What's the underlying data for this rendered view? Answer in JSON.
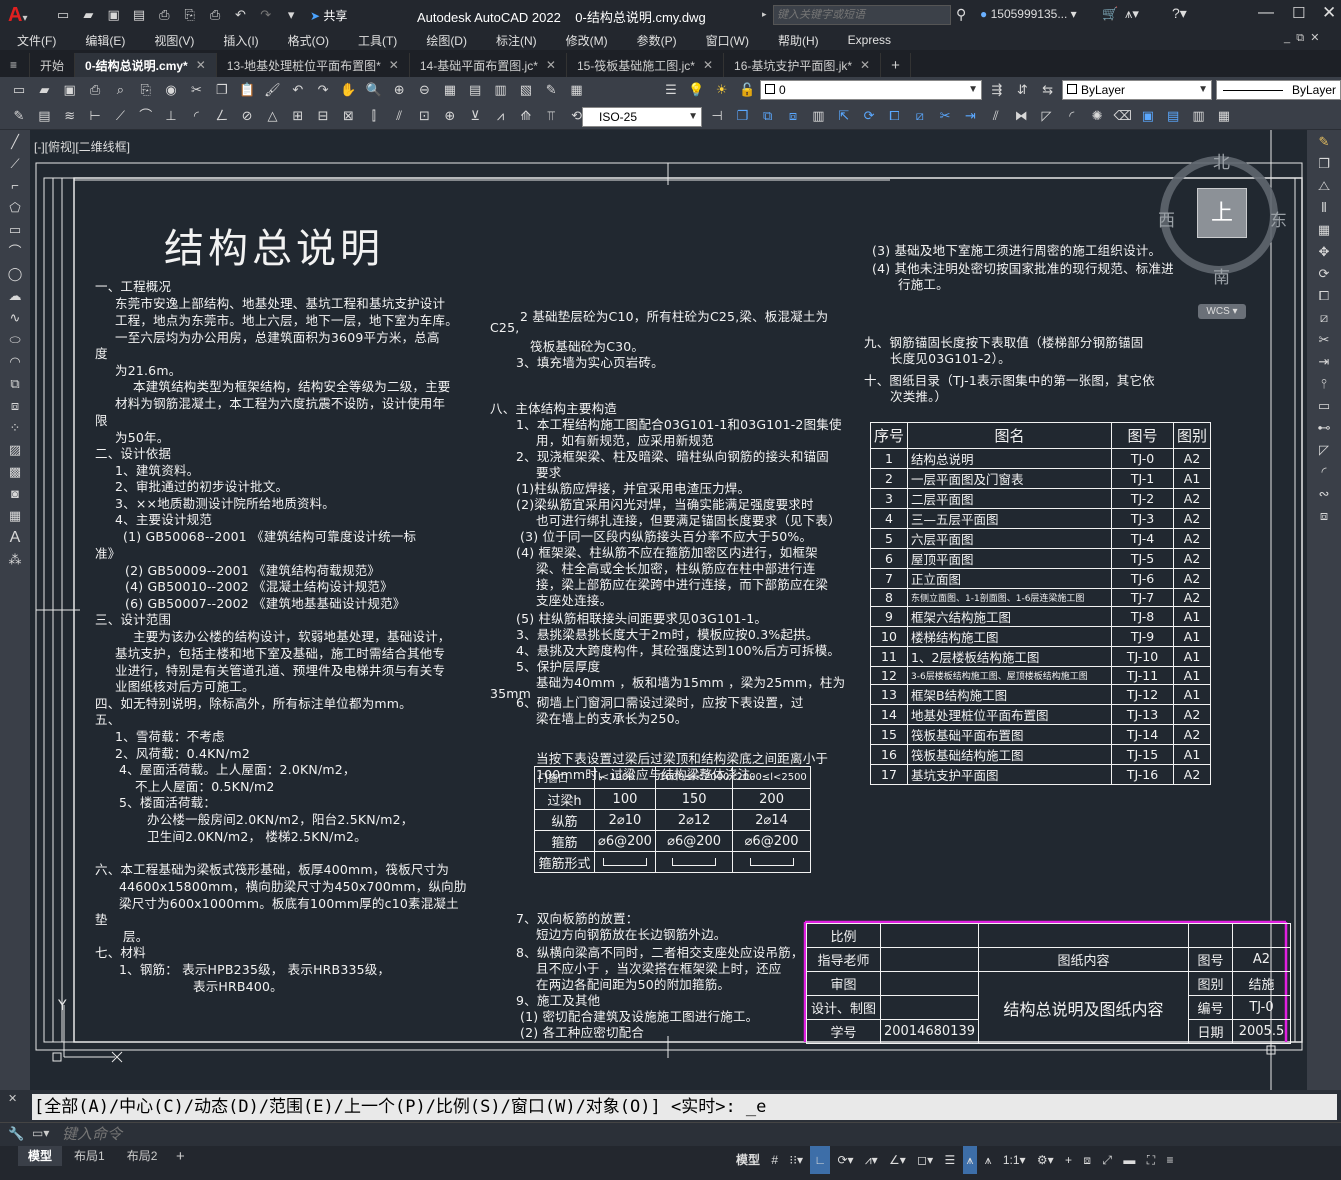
{
  "app": {
    "title": "Autodesk AutoCAD 2022",
    "file": "0-结构总说明.cmy.dwg",
    "share": "共享",
    "search_placeholder": "键入关键字或短语",
    "user": "1505999135...",
    "logo": "A"
  },
  "menu": [
    "文件(F)",
    "编辑(E)",
    "视图(V)",
    "插入(I)",
    "格式(O)",
    "工具(T)",
    "绘图(D)",
    "标注(N)",
    "修改(M)",
    "参数(P)",
    "窗口(W)",
    "帮助(H)",
    "Express"
  ],
  "tabs": [
    {
      "label": "开始",
      "active": false,
      "closable": false
    },
    {
      "label": "0-结构总说明.cmy*",
      "active": true,
      "closable": true
    },
    {
      "label": "13-地基处理桩位平面布置图*",
      "active": false,
      "closable": true
    },
    {
      "label": "14-基础平面布置图.jc*",
      "active": false,
      "closable": true
    },
    {
      "label": "15-筏板基础施工图.jc*",
      "active": false,
      "closable": true
    },
    {
      "label": "16-基坑支护平面图.jk*",
      "active": false,
      "closable": true
    }
  ],
  "toolbar": {
    "layer_value": "0",
    "color_value": "ByLayer",
    "linetype_value": "ByLayer",
    "dimstyle_value": "ISO-25"
  },
  "viewport_label": "[-][俯视][二维线框]",
  "viewcube": {
    "north": "北",
    "south": "南",
    "east": "东",
    "west": "西",
    "top": "上",
    "wcs": "WCS"
  },
  "drawing": {
    "title": "结构总说明",
    "col1": [
      "一、工程概况",
      "东莞市安逸上部结构、地基处理、基坑工程和基坑支护设计",
      "工程，地点为东莞市。地上六层，地下一层，地下室为车库。",
      "一至六层均为办公用房，总建筑面积为3609平方米，总高",
      "度",
      "为21.6m。",
      "本建筑结构类型为框架结构，结构安全等级为二级，主要",
      "材料为钢筋混凝土，本工程为六度抗震不设防，设计使用年",
      "限",
      "为50年。",
      "二、设计依据",
      "1、建筑资料。",
      "2、审批通过的初步设计批文。",
      "3、××地质勘测设计院所给地质资料。",
      "4、主要设计规范",
      "(1) GB50068--2001 《建筑结构可靠度设计统一标",
      "准》",
      "(2) GB50009--2001 《建筑结构荷载规范》",
      "(4) GB50010--2002 《混凝土结构设计规范》",
      "(6) GB50007--2002 《建筑地基基础设计规范》",
      "三、设计范围",
      "主要为该办公楼的结构设计，软弱地基处理，基础设计，",
      "基坑支护，包括主楼和地下室及基础，施工时需结合其他专",
      "业进行，特别是有关管道孔道、预埋件及电梯井须与有关专",
      "业图纸核对后方可施工。",
      "四、如无特别说明，除标高外，所有标注单位都为mm。",
      "五、",
      "1、雪荷载：不考虑",
      "2、风荷载：0.4KN/m2",
      "4、屋面活荷载。上人屋面：2.0KN/m2，",
      "不上人屋面：0.5KN/m2",
      "5、楼面活荷载：",
      "办公楼一般房间2.0KN/m2，阳台2.5KN/m2，",
      "卫生间2.0KN/m2， 楼梯2.5KN/m2。",
      "六、本工程基础为梁板式筏形基础，板厚400mm，筏板尺寸为",
      "44600x15800mm，横向肋梁尺寸为450x700mm，纵向肋",
      "梁尺寸为600x1000mm。板底有100mm厚的c10素混凝土",
      "垫",
      "层。",
      "七、材料",
      "1、钢筋： 表示HPB235级， 表示HRB335级，",
      "表示HRB400。"
    ],
    "col2": [
      "2 基础垫层砼为C10，所有柱砼为C25,梁、板混凝土为",
      "C25,",
      "筏板基础砼为C30。",
      "3、填充墙为实心页岩砖。",
      "八、主体结构主要构造",
      "1、本工程结构施工图配合03G101-1和03G101-2图集使",
      "用，如有新规范，应采用新规范",
      "2、现浇框架梁、柱及暗梁、暗柱纵向钢筋的接头和锚固",
      "要求",
      "(1)柱纵筋应焊接，并宜采用电渣压力焊。",
      "(2)梁纵筋宜采用闪光对焊，当确实能满足强度要求时",
      "也可进行绑扎连接，但要满足锚固长度要求（见下表）",
      "(3) 位于同一区段内纵筋接头百分率不应大于50%。",
      "(4) 框架梁、柱纵筋不应在箍筋加密区内进行，如框架",
      "梁、柱全高或全长加密，柱纵筋应在柱中部进行连",
      "接，梁上部筋应在梁跨中进行连接，而下部筋应在梁",
      "支座处连接。",
      "(5) 柱纵筋相联接头间距要求见03G101-1。",
      "3、悬挑梁悬挑长度大于2m时，模板应按0.3%起拱。",
      "4、悬挑及大跨度构件，其砼强度达到100%后方可拆模。",
      "5、保护层厚度",
      "基础为40mm ，板和墙为15mm ，梁为25mm，柱为",
      "35mm",
      "6、砌墙上门窗洞口需设过梁时，应按下表设置，过",
      "梁在墙上的支承长为250。",
      "当按下表设置过梁后过梁顶和结构梁底之间距离小于",
      "100mm时，过梁应与结构梁整体浇注。",
      "7、双向板筋的放置：",
      "短边方向钢筋放在长边钢筋外边。",
      "8、纵横向梁高不同时，二者相交支座处应设吊筋，",
      "且不应小于 ，当次梁搭在框架梁上时，还应",
      "在两边各配间距为50的附加箍筋。",
      "9、施工及其他",
      "(1) 密切配合建筑及设施施工图进行施工。",
      "(2) 各工种应密切配合"
    ],
    "col3": [
      "(3) 基础及地下室施工须进行周密的施工组织设计。",
      "(4) 其他未注明处密切按国家批准的现行规范、标准进",
      "行施工。",
      "九、钢筋锚固长度按下表取值（楼梯部分钢筋锚固",
      "长度见03G101-2）。",
      "十、图纸目录（TJ-1表示图集中的第一张图，其它依",
      "次类推。）"
    ],
    "lintel_table": {
      "header": [
        "门窗口",
        "l<1000",
        "1000≤l<2000",
        "2000≤l<2500"
      ],
      "rows": [
        [
          "过梁h",
          "100",
          "150",
          "200"
        ],
        [
          "纵筋",
          "2⌀10",
          "2⌀12",
          "2⌀14"
        ],
        [
          "箍筋",
          "⌀6@200",
          "⌀6@200",
          "⌀6@200"
        ],
        [
          "箍筋形式",
          "",
          "",
          ""
        ]
      ]
    },
    "index_table": {
      "header": [
        "序号",
        "图名",
        "图号",
        "图别"
      ],
      "rows": [
        [
          "1",
          "结构总说明",
          "TJ-0",
          "A2"
        ],
        [
          "2",
          "一层平面图及门窗表",
          "TJ-1",
          "A1"
        ],
        [
          "3",
          "二层平面图",
          "TJ-2",
          "A2"
        ],
        [
          "4",
          "三—五层平面图",
          "TJ-3",
          "A2"
        ],
        [
          "5",
          "六层平面图",
          "TJ-4",
          "A2"
        ],
        [
          "6",
          "屋顶平面图",
          "TJ-5",
          "A2"
        ],
        [
          "7",
          "正立面图",
          "TJ-6",
          "A2"
        ],
        [
          "8",
          "东侧立面图、1-1剖面图、1-6层连梁施工图",
          "TJ-7",
          "A2"
        ],
        [
          "9",
          "框架六结构施工图",
          "TJ-8",
          "A1"
        ],
        [
          "10",
          "楼梯结构施工图",
          "TJ-9",
          "A1"
        ],
        [
          "11",
          "1、2层楼板结构施工图",
          "TJ-10",
          "A1"
        ],
        [
          "12",
          "3-6层楼板结构施工图、屋顶楼板结构施工图",
          "TJ-11",
          "A1"
        ],
        [
          "13",
          "框架B结构施工图",
          "TJ-12",
          "A1"
        ],
        [
          "14",
          "地基处理桩位平面布置图",
          "TJ-13",
          "A2"
        ],
        [
          "15",
          "筏板基础平面布置图",
          "TJ-14",
          "A2"
        ],
        [
          "16",
          "筏板基础结构施工图",
          "TJ-15",
          "A1"
        ],
        [
          "17",
          "基坑支护平面图",
          "TJ-16",
          "A2"
        ]
      ]
    },
    "titleblock": {
      "bili": "比例",
      "advisor": "指导老师",
      "review": "审图",
      "designer": "设计、制图",
      "student_id_label": "学号",
      "student_id": "20014680139",
      "content_label": "图纸内容",
      "content": "结构总说明及图纸内容",
      "tuhao_label": "图号",
      "tuhao": "A2",
      "tubie_label": "图别",
      "tubie": "结施",
      "biaohao_label": "编号",
      "biaohao": "TJ-0",
      "date_label": "日期",
      "date": "2005.5"
    }
  },
  "command": {
    "history": "[全部(A)/中心(C)/动态(D)/范围(E)/上一个(P)/比例(S)/窗口(W)/对象(O)] <实时>: _e",
    "placeholder": "键入命令"
  },
  "layout_tabs": [
    "模型",
    "布局1",
    "布局2"
  ],
  "status": {
    "model": "模型",
    "scale": "1:1"
  },
  "colors": {
    "canvas_bg": "#212830",
    "titleblock_accent": "#e020e0",
    "ui_bg": "#3a3f48"
  }
}
